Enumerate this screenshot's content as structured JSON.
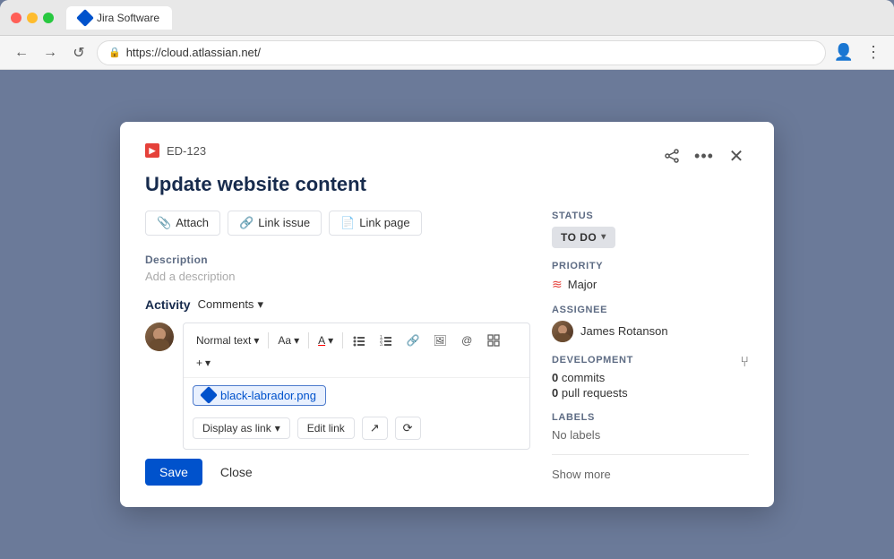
{
  "browser": {
    "tab_label": "Jira Software",
    "url": "https://cloud.atlassian.net/",
    "nav": {
      "back": "←",
      "forward": "→",
      "reload": "↺"
    }
  },
  "modal": {
    "issue_id": "ED-123",
    "issue_title": "Update website content",
    "close_btn": "×",
    "more_btn": "•••",
    "share_btn": "share",
    "actions": {
      "attach": "Attach",
      "link_issue": "Link issue",
      "link_page": "Link page"
    },
    "description": {
      "label": "Description",
      "placeholder": "Add a description"
    },
    "activity": {
      "label": "Activity",
      "dropdown": "Comments",
      "dropdown_chevron": "▾"
    },
    "editor": {
      "text_style": "Normal text",
      "aa_btn": "Aa",
      "a_btn": "A",
      "attached_file": "black-labrador.png",
      "display_link_btn": "Display as link",
      "edit_link_btn": "Edit link"
    },
    "footer": {
      "save_btn": "Save",
      "close_btn": "Close"
    }
  },
  "sidebar": {
    "status": {
      "label": "STATUS",
      "value": "TO DO"
    },
    "priority": {
      "label": "PRIORITY",
      "value": "Major"
    },
    "assignee": {
      "label": "ASSIGNEE",
      "value": "James Rotanson"
    },
    "development": {
      "label": "DEVELOPMENT",
      "commits": "0 commits",
      "pull_requests": "0 pull requests"
    },
    "labels": {
      "label": "LABELS",
      "value": "No labels"
    },
    "show_more": "Show more"
  }
}
